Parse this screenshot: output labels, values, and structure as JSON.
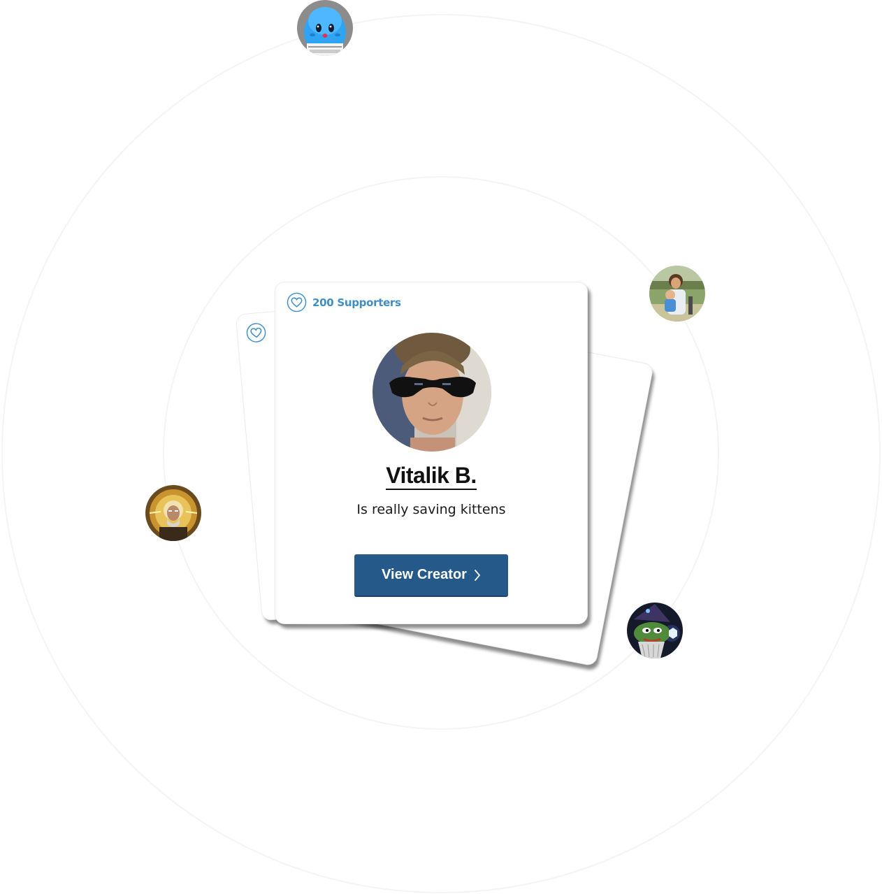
{
  "creator_card": {
    "supporters_label": "200 Supporters",
    "name": "Vitalik B.",
    "tagline": "Is really saving kittens",
    "button_label": "View Creator",
    "heart_icon": "heart-outline-icon",
    "button_icon": "chevron-right-icon"
  },
  "colors": {
    "accent_blue": "#3f8ec7",
    "button_blue": "#24598a",
    "text_dark": "#111111"
  },
  "orbiting_avatars": [
    {
      "name": "avatar-blue-mascot"
    },
    {
      "name": "avatar-family-photo"
    },
    {
      "name": "avatar-wizard"
    },
    {
      "name": "avatar-pepe"
    }
  ]
}
